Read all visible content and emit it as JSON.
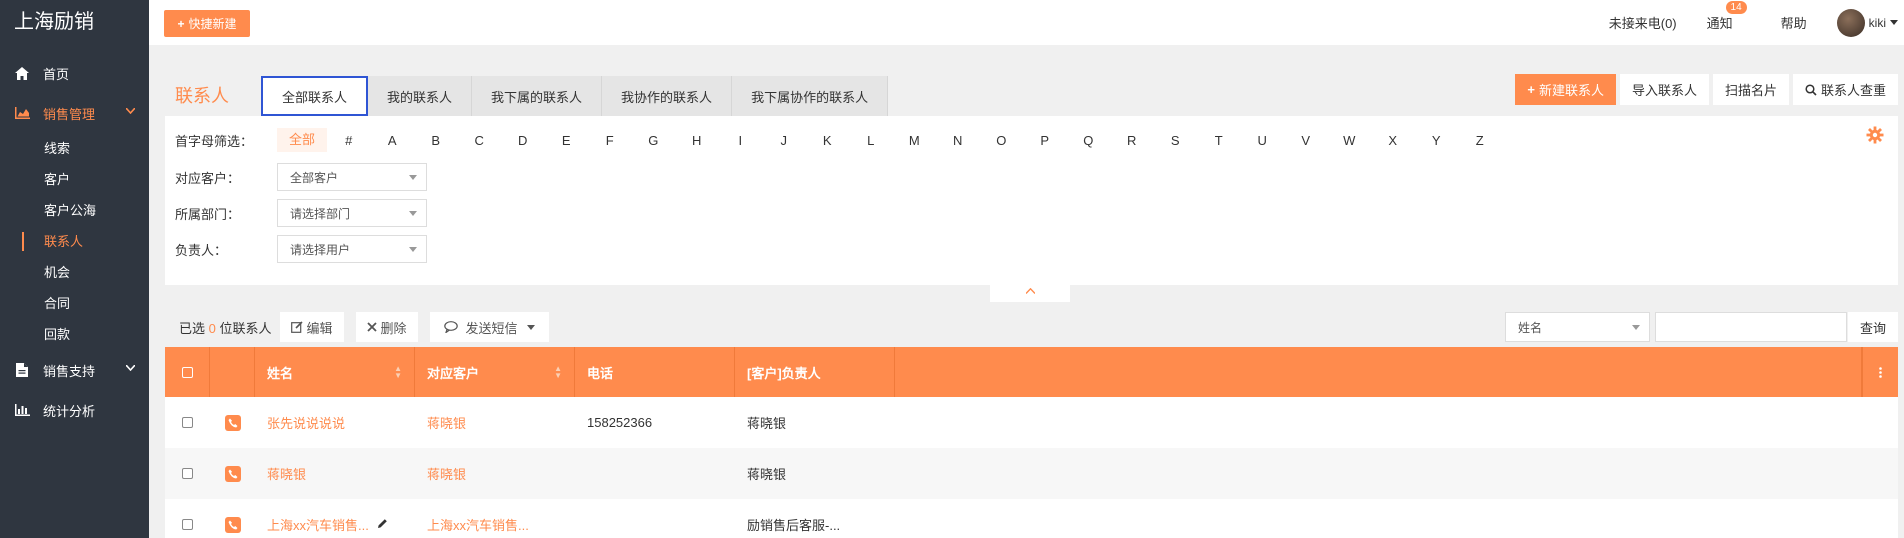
{
  "brand": "上海励销",
  "sidebar": {
    "items": [
      {
        "label": "首页",
        "icon": "home-icon"
      },
      {
        "label": "销售管理",
        "icon": "area-chart-icon"
      },
      {
        "label": "销售支持",
        "icon": "document-icon"
      },
      {
        "label": "统计分析",
        "icon": "bar-chart-icon"
      }
    ],
    "sub_items": [
      "线索",
      "客户",
      "客户公海",
      "联系人",
      "机会",
      "合同",
      "回款"
    ],
    "active_sub": "联系人"
  },
  "topbar": {
    "quick_new": "快捷新建",
    "missed_calls": "未接来电(0)",
    "notifications": "通知",
    "notification_count": "14",
    "help": "帮助",
    "username": "kiki"
  },
  "page": {
    "title": "联系人",
    "tabs": [
      "全部联系人",
      "我的联系人",
      "我下属的联系人",
      "我协作的联系人",
      "我下属协作的联系人"
    ],
    "actions": {
      "new_contact": "新建联系人",
      "import": "导入联系人",
      "scan_card": "扫描名片",
      "dedupe": "联系人查重"
    }
  },
  "filters": {
    "initial_label": "首字母筛选：",
    "letters": [
      "全部",
      "#",
      "A",
      "B",
      "C",
      "D",
      "E",
      "F",
      "G",
      "H",
      "I",
      "J",
      "K",
      "L",
      "M",
      "N",
      "O",
      "P",
      "Q",
      "R",
      "S",
      "T",
      "U",
      "V",
      "W",
      "X",
      "Y",
      "Z"
    ],
    "customer_label": "对应客户：",
    "customer_value": "全部客户",
    "dept_label": "所属部门：",
    "dept_placeholder": "请选择部门",
    "owner_label": "负责人：",
    "owner_placeholder": "请选择用户"
  },
  "toolbar": {
    "selected_prefix": "已选",
    "selected_count": "0",
    "selected_suffix": "位联系人",
    "edit": "编辑",
    "delete": "删除",
    "send_sms": "发送短信",
    "search_field": "姓名",
    "search_value": "",
    "query": "查询"
  },
  "table": {
    "headers": [
      "姓名",
      "对应客户",
      "电话",
      "[客户]负责人"
    ],
    "rows": [
      {
        "name": "张先说说说说",
        "customer": "蒋晓银",
        "phone": "158252366",
        "owner": "蒋晓银"
      },
      {
        "name": "蒋晓银",
        "customer": "蒋晓银",
        "phone": "",
        "owner": "蒋晓银"
      },
      {
        "name": "上海xx汽车销售...",
        "customer": "上海xx汽车销售...",
        "phone": "",
        "owner": "励销售后客服-..."
      }
    ]
  },
  "colors": {
    "accent": "#ff8b4d",
    "sidebar_bg": "#2f3640",
    "active_tab_border": "#2f55d4"
  }
}
